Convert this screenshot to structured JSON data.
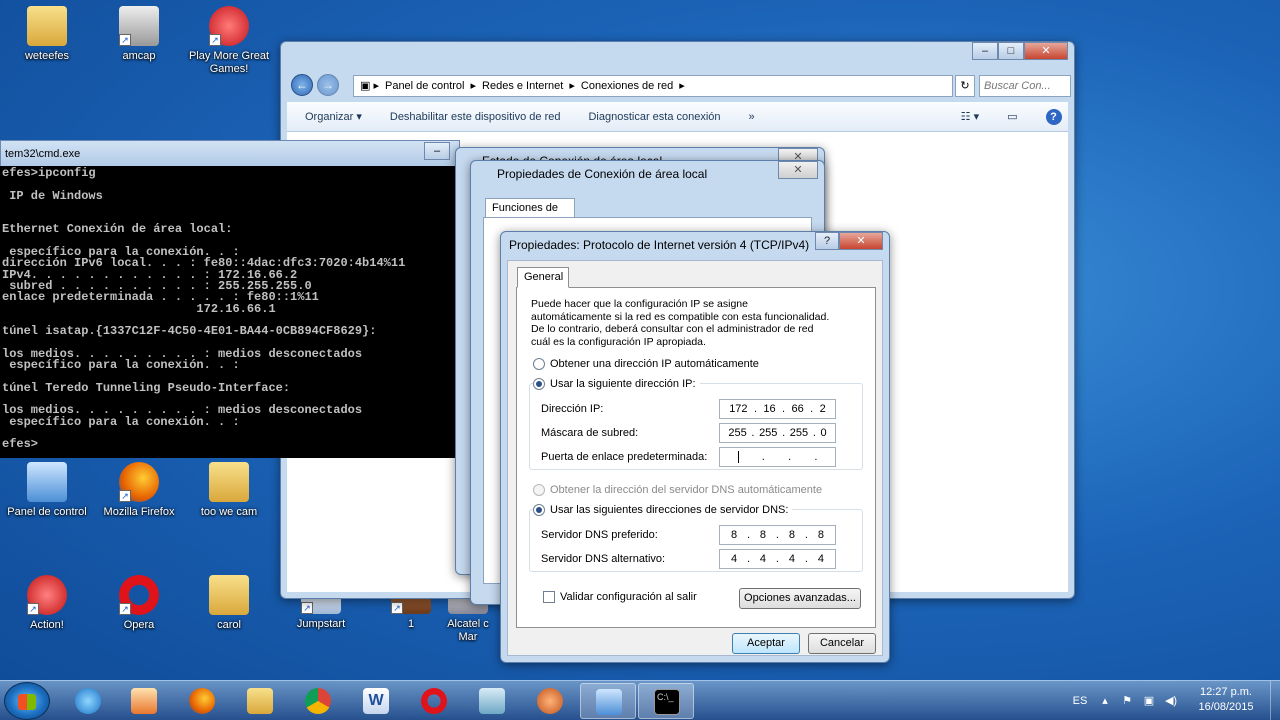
{
  "desktop": {
    "icons": [
      {
        "label": "weteefes"
      },
      {
        "label": "amcap"
      },
      {
        "label": "Play More Great Games!"
      },
      {
        "label": "Panel de control"
      },
      {
        "label": "Mozilla Firefox"
      },
      {
        "label": "too we cam"
      },
      {
        "label": "Action!"
      },
      {
        "label": "Opera"
      },
      {
        "label": "carol"
      },
      {
        "label": "Jumpstart"
      },
      {
        "label": "1"
      },
      {
        "label": "Alcatel c Mar"
      }
    ]
  },
  "explorer": {
    "breadcrumb": [
      "Panel de control",
      "Redes e Internet",
      "Conexiones de red"
    ],
    "search_placeholder": "Buscar Con...",
    "toolbar": {
      "organize": "Organizar ▾",
      "disable": "Deshabilitar este dispositivo de red",
      "diagnose": "Diagnosticar esta conexión",
      "more": "»"
    }
  },
  "cmd": {
    "title": "tem32\\cmd.exe",
    "lines": [
      "efes>ipconfig",
      "",
      " IP de Windows",
      "",
      "",
      "Ethernet Conexión de área local:",
      "",
      " específico para la conexión. . :",
      "dirección IPv6 local. . . : fe80::4dac:dfc3:7020:4b14%11",
      "IPv4. . . . . . . . . . . . : 172.16.66.2",
      " subred . . . . . . . . . . : 255.255.255.0",
      "enlace predeterminada . . . . . : fe80::1%11",
      "                           172.16.66.1",
      "",
      "túnel isatap.{1337C12F-4C50-4E01-BA44-0CB894CF8629}:",
      "",
      "los medios. . . . . . . . . : medios desconectados",
      " específico para la conexión. . :",
      "",
      "túnel Teredo Tunneling Pseudo-Interface:",
      "",
      "los medios. . . . . . . . . : medios desconectados",
      " específico para la conexión. . :",
      "",
      "efes>"
    ]
  },
  "status_window": {
    "title": "Estado de Conexión de área local"
  },
  "props_window": {
    "title": "Propiedades de Conexión de área local",
    "tab": "Funciones de red"
  },
  "ipv4": {
    "title": "Propiedades: Protocolo de Internet versión 4 (TCP/IPv4)",
    "tab": "General",
    "description": "Puede hacer que la configuración IP se asigne automáticamente si la red es compatible con esta funcionalidad. De lo contrario, deberá consultar con el administrador de red cuál es la configuración IP apropiada.",
    "radio_auto_ip": "Obtener una dirección IP automáticamente",
    "radio_manual_ip": "Usar la siguiente dirección IP:",
    "ip_label": "Dirección IP:",
    "ip": [
      "172",
      "16",
      "66",
      "2"
    ],
    "mask_label": "Máscara de subred:",
    "mask": [
      "255",
      "255",
      "255",
      "0"
    ],
    "gateway_label": "Puerta de enlace predeterminada:",
    "gateway": [
      "",
      "",
      "",
      ""
    ],
    "radio_auto_dns": "Obtener la dirección del servidor DNS automáticamente",
    "radio_manual_dns": "Usar las siguientes direcciones de servidor DNS:",
    "dns1_label": "Servidor DNS preferido:",
    "dns1": [
      "8",
      "8",
      "8",
      "8"
    ],
    "dns2_label": "Servidor DNS alternativo:",
    "dns2": [
      "4",
      "4",
      "4",
      "4"
    ],
    "validate_label": "Validar configuración al salir",
    "advanced_button": "Opciones avanzadas...",
    "ok_button": "Aceptar",
    "cancel_button": "Cancelar"
  },
  "taskbar": {
    "language": "ES",
    "time": "12:27 p.m.",
    "date": "16/08/2015"
  },
  "colors": {
    "desktop": "#1c64b8",
    "accent": "#3c7fb1"
  }
}
